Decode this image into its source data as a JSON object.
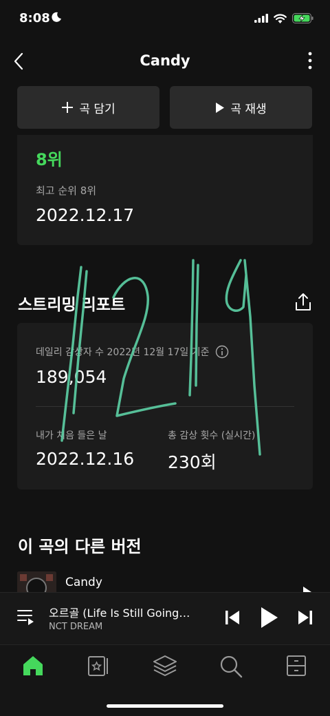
{
  "status_bar": {
    "time": "8:08"
  },
  "header": {
    "title": "Candy"
  },
  "actions": {
    "add_label": "곡 담기",
    "play_label": "곡 재생"
  },
  "rank": {
    "current": "8위",
    "best_label": "최고 순위 8위",
    "best_date": "2022.12.17"
  },
  "report": {
    "title": "스트리밍 리포트",
    "daily_label": "데일리 감상자 수 2022년 12월 17일 기준",
    "daily_value": "189,054",
    "first_label": "내가 처음 들은 날",
    "first_value": "2022.12.16",
    "total_label": "총 감상 횟수 (실시간)",
    "total_value": "230회"
  },
  "handwriting": {
    "text": "1219",
    "color": "#5dd1a6"
  },
  "versions": {
    "title": "이 곡의 다른 버전",
    "items": [
      {
        "name": "Candy"
      }
    ]
  },
  "player": {
    "track_title": "오르골 (Life Is Still Going…",
    "artist": "NCT DREAM"
  },
  "tabs": [
    {
      "icon": "home-icon",
      "active": true
    },
    {
      "icon": "library-icon"
    },
    {
      "icon": "layers-icon"
    },
    {
      "icon": "search-icon"
    },
    {
      "icon": "storage-icon"
    }
  ],
  "colors": {
    "accent": "#45d85c",
    "background": "#121212",
    "card": "#1c1c1c"
  }
}
